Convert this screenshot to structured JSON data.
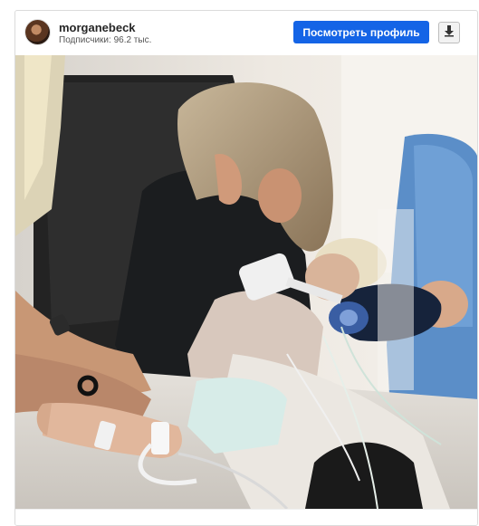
{
  "post": {
    "username": "morganebeck",
    "followers_text": "Подписчики: 96.2 тыс.",
    "view_profile_label": "Посмотреть профиль",
    "download_icon": "download-icon",
    "accent_color": "#1464e6"
  }
}
